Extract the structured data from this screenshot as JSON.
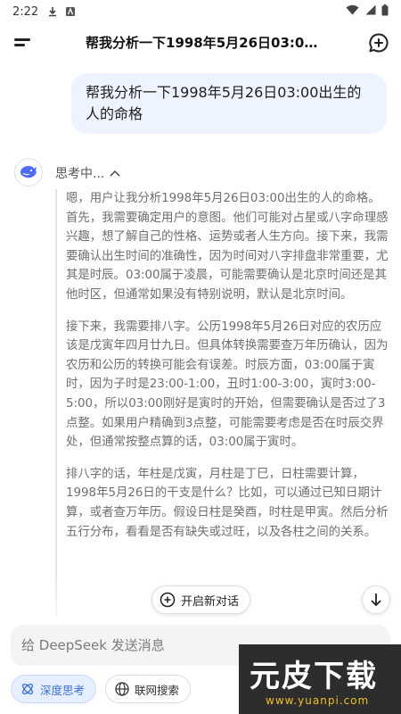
{
  "status_bar": {
    "time": "2:22",
    "icons": [
      "download-icon",
      "notification-app-icon",
      "wifi-icon",
      "signal-icon",
      "battery-icon"
    ]
  },
  "header": {
    "title": "帮我分析一下1998年5月26日03:00...",
    "icons": [
      "menu-icon",
      "new-chat-icon"
    ]
  },
  "user_message": {
    "text": "帮我分析一下1998年5月26日03:00出生的人的命格"
  },
  "assistant": {
    "avatar_icon": "deepseek-whale-icon",
    "thinking_label": "思考中...",
    "thinking_paragraphs": [
      "嗯，用户让我分析1998年5月26日03:00出生的人的命格。首先，我需要确定用户的意图。他们可能对占星或八字命理感兴趣，想了解自己的性格、运势或者人生方向。接下来，我需要确认出生时间的准确性，因为时间对八字排盘非常重要，尤其是时辰。03:00属于凌晨，可能需要确认是北京时间还是其他时区，但通常如果没有特别说明，默认是北京时间。",
      "接下来，我需要排八字。公历1998年5月26日对应的农历应该是戊寅年四月廿九日。但具体转换需要查万年历确认，因为农历和公历的转换可能会有误差。时辰方面，03:00属于寅时，因为子时是23:00-1:00，丑时1:00-3:00，寅时3:00-5:00，所以03:00刚好是寅时的开始，但需要确认是否过了3点整。如果用户精确到3点整，可能需要考虑是否在时辰交界处，但通常按整点算的话，03:00属于寅时。",
      "排八字的话，年柱是戊寅，月柱是丁巳，日柱需要计算，1998年5月26日的干支是什么？比如，可以通过已知日期计算，或者查万年历。假设日柱是癸酉，时柱是甲寅。然后分析五行分布，看看是否有缺失或过旺，以及各柱之间的关系。"
    ]
  },
  "floating": {
    "new_conversation_label": "开启新对话",
    "scroll_down_icon": "arrow-down-icon"
  },
  "composer": {
    "placeholder": "给 DeepSeek 发送消息",
    "deep_think_label": "深度思考",
    "web_search_label": "联网搜索"
  },
  "watermark": {
    "brand": "元皮下载",
    "url": "www.yuanpi.com"
  },
  "colors": {
    "accent": "#3d6fe0",
    "bubble": "#eef4ff",
    "thinking_text": "#6f6f6f"
  }
}
